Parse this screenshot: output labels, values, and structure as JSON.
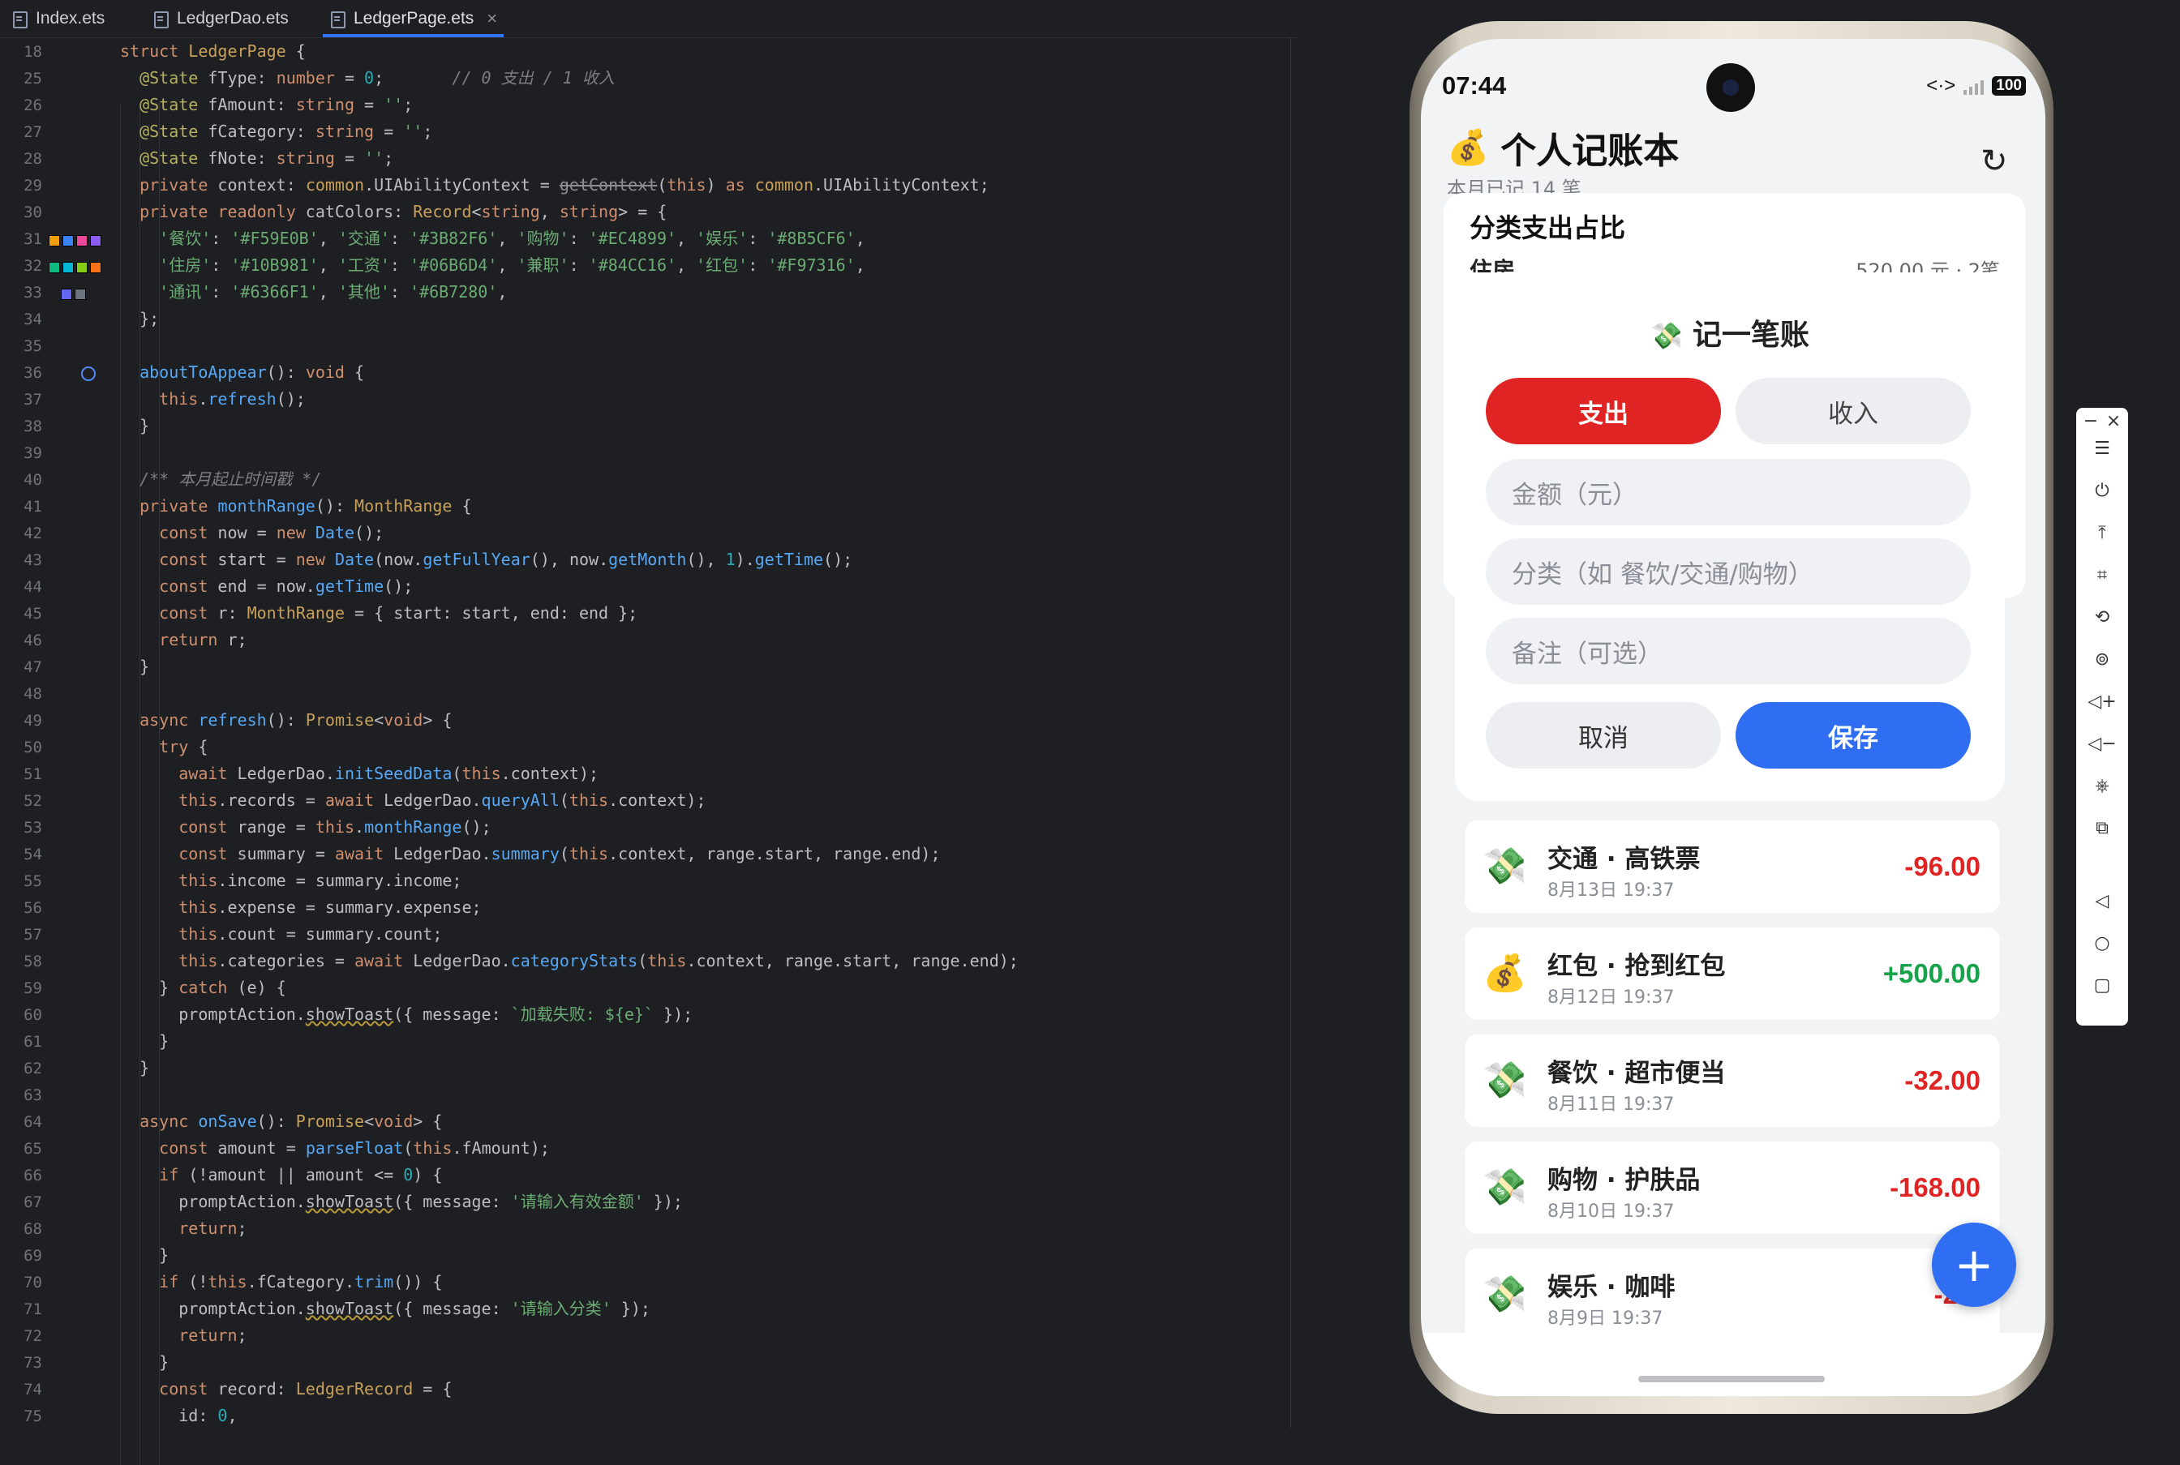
{
  "editor": {
    "tabs": [
      {
        "label": "Index.ets"
      },
      {
        "label": "LedgerDao.ets"
      },
      {
        "label": "LedgerPage.ets",
        "close": "×"
      }
    ],
    "line_numbers": [
      "18",
      "25",
      "26",
      "27",
      "28",
      "29",
      "30",
      "31",
      "32",
      "33",
      "34",
      "35",
      "36",
      "37",
      "38",
      "39",
      "40",
      "41",
      "42",
      "43",
      "44",
      "45",
      "46",
      "47",
      "48",
      "49",
      "50",
      "51",
      "52",
      "53",
      "54",
      "55",
      "56",
      "57",
      "58",
      "59",
      "60",
      "61",
      "62",
      "63",
      "64",
      "65",
      "66",
      "67",
      "68",
      "69",
      "70",
      "71",
      "72",
      "73",
      "74",
      "75"
    ],
    "swatch_colors": [
      [
        "#F59E0B",
        "#3B82F6",
        "#EC4899",
        "#8B5CF6"
      ],
      [
        "#10B981",
        "#06B6D4",
        "#84CC16",
        "#F97316"
      ],
      [
        "#6366F1",
        "#6B7280"
      ]
    ]
  },
  "phone": {
    "status": {
      "time": "07:44",
      "net": "<·>",
      "battery": "100"
    },
    "app_title": "个人记账本",
    "app_emoji": "💰",
    "subtitle": "本月已记 14 笔",
    "refresh_icon": "↻",
    "summary_card": {
      "title": "分类支出占比",
      "row_label": "住房",
      "row_value": "520.00 元 · 2笔"
    },
    "dialog": {
      "title": "记一笔账",
      "emoji": "💸",
      "type_expense": "支出",
      "type_income": "收入",
      "amount_placeholder": "金额（元）",
      "category_placeholder": "分类（如 餐饮/交通/购物）",
      "note_placeholder": "备注（可选）",
      "cancel": "取消",
      "save": "保存"
    },
    "records": [
      {
        "icon": "💸",
        "title": "交通 · 高铁票",
        "time": "8月13日 19:37",
        "amount": "-96.00",
        "color": "#e02424"
      },
      {
        "icon": "💰",
        "title": "红包 · 抢到红包",
        "time": "8月12日 19:37",
        "amount": "+500.00",
        "color": "#16a34a"
      },
      {
        "icon": "💸",
        "title": "餐饮 · 超市便当",
        "time": "8月11日 19:37",
        "amount": "-32.00",
        "color": "#e02424"
      },
      {
        "icon": "💸",
        "title": "购物 · 护肤品",
        "time": "8月10日 19:37",
        "amount": "-168.00",
        "color": "#e02424"
      },
      {
        "icon": "💸",
        "title": "娱乐 · 咖啡",
        "time": "8月9日 19:37",
        "amount": "-2",
        "color": "#e02424"
      }
    ],
    "fab": "+"
  },
  "emulator_toolbar": {
    "buttons": [
      "−",
      "×",
      "☰",
      "⏻",
      "⤒",
      "⌗",
      "⟲",
      "⊚",
      "◁+",
      "◁−",
      "⎈",
      "⧉",
      "◁",
      "○",
      "▢"
    ]
  }
}
